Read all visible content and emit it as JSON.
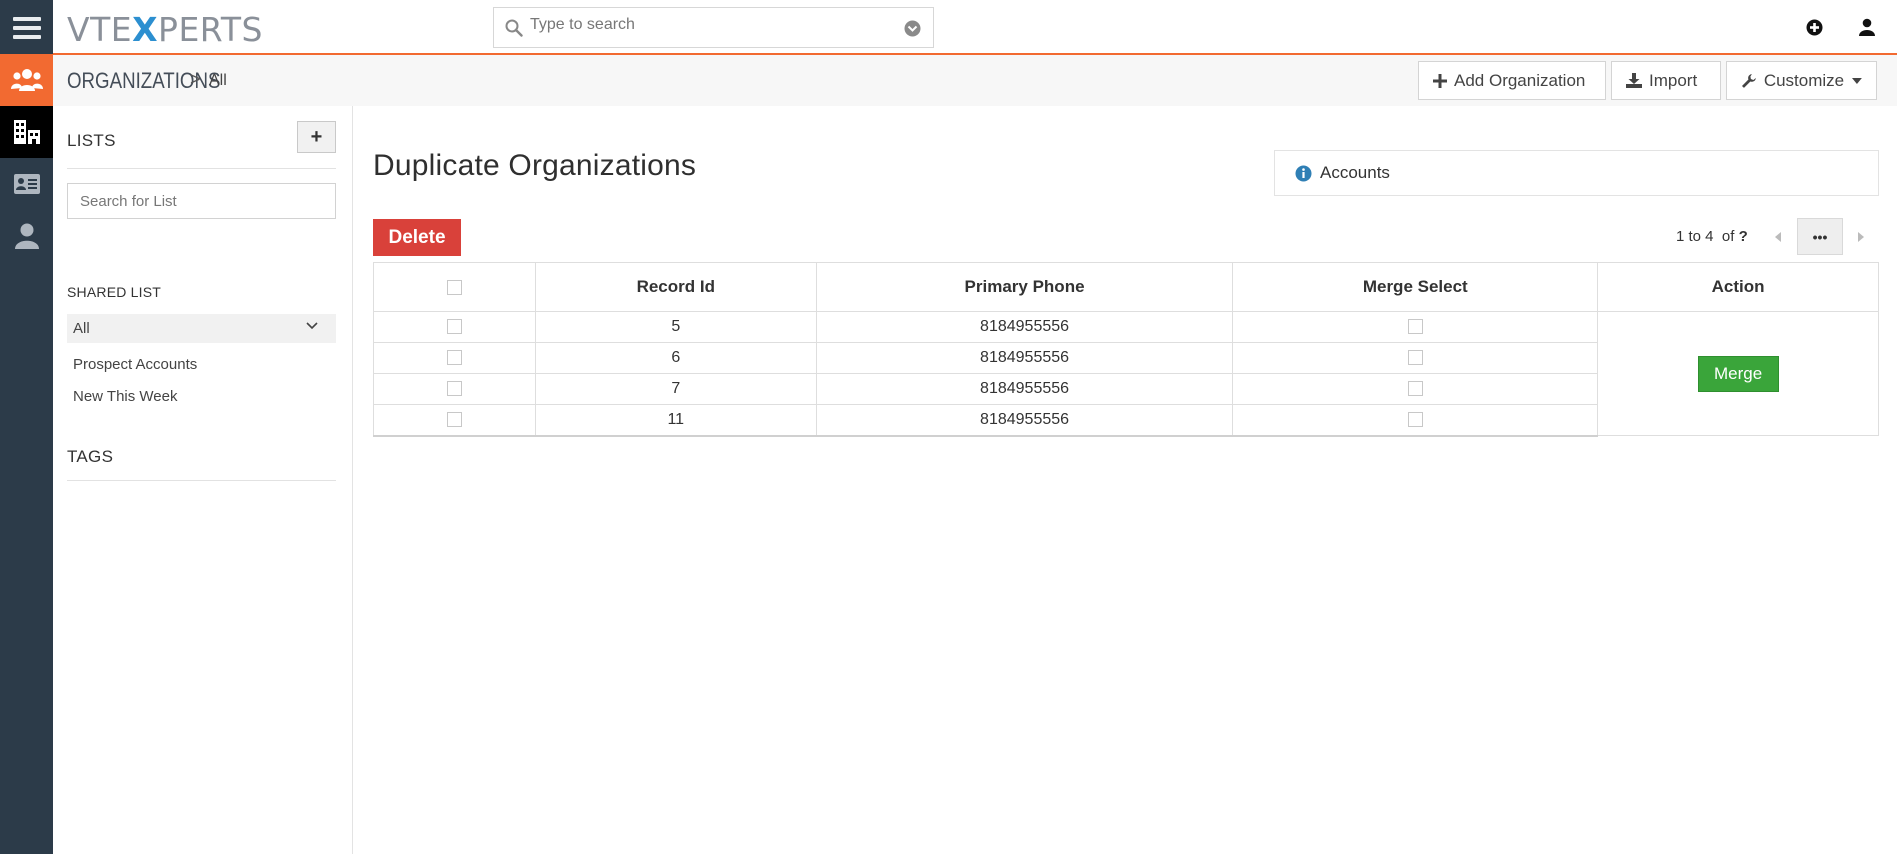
{
  "header": {
    "logo_left": "VTE",
    "logo_x": "X",
    "logo_right": "PERTS",
    "search_placeholder": "Type to search"
  },
  "breadcrumb": {
    "module": "ORGANIZATIONS",
    "separator": ">",
    "view": "All"
  },
  "actions": {
    "add_label": "Add Organization",
    "import_label": "Import",
    "customize_label": "Customize"
  },
  "lists": {
    "title": "LISTS",
    "add_symbol": "+",
    "search_placeholder": "Search for List",
    "shared_title": "SHARED LIST",
    "selected": "All",
    "items": [
      "Prospect Accounts",
      "New This Week"
    ],
    "tags_title": "TAGS"
  },
  "main": {
    "title": "Duplicate Organizations",
    "info_label": "Accounts",
    "delete_label": "Delete",
    "pager_range": "1 to 4",
    "pager_of": "of",
    "pager_total": "?",
    "pager_more": "•••"
  },
  "table": {
    "columns": [
      "",
      "Record Id",
      "Primary Phone",
      "Merge Select",
      "Action"
    ],
    "rows": [
      {
        "id": "5",
        "phone": "8184955556"
      },
      {
        "id": "6",
        "phone": "8184955556"
      },
      {
        "id": "7",
        "phone": "8184955556"
      },
      {
        "id": "11",
        "phone": "8184955556"
      }
    ],
    "merge_label": "Merge"
  },
  "colors": {
    "accent": "#f26a31",
    "rail": "#2c3b49",
    "delete": "#d9413a",
    "merge": "#3aa53a"
  },
  "icons": {
    "rail": [
      "menu-icon",
      "organizations-group-icon",
      "building-icon",
      "contact-card-icon",
      "person-icon"
    ],
    "top": [
      "search-icon",
      "dropdown-circle-icon",
      "add-circle-icon",
      "user-icon"
    ]
  }
}
